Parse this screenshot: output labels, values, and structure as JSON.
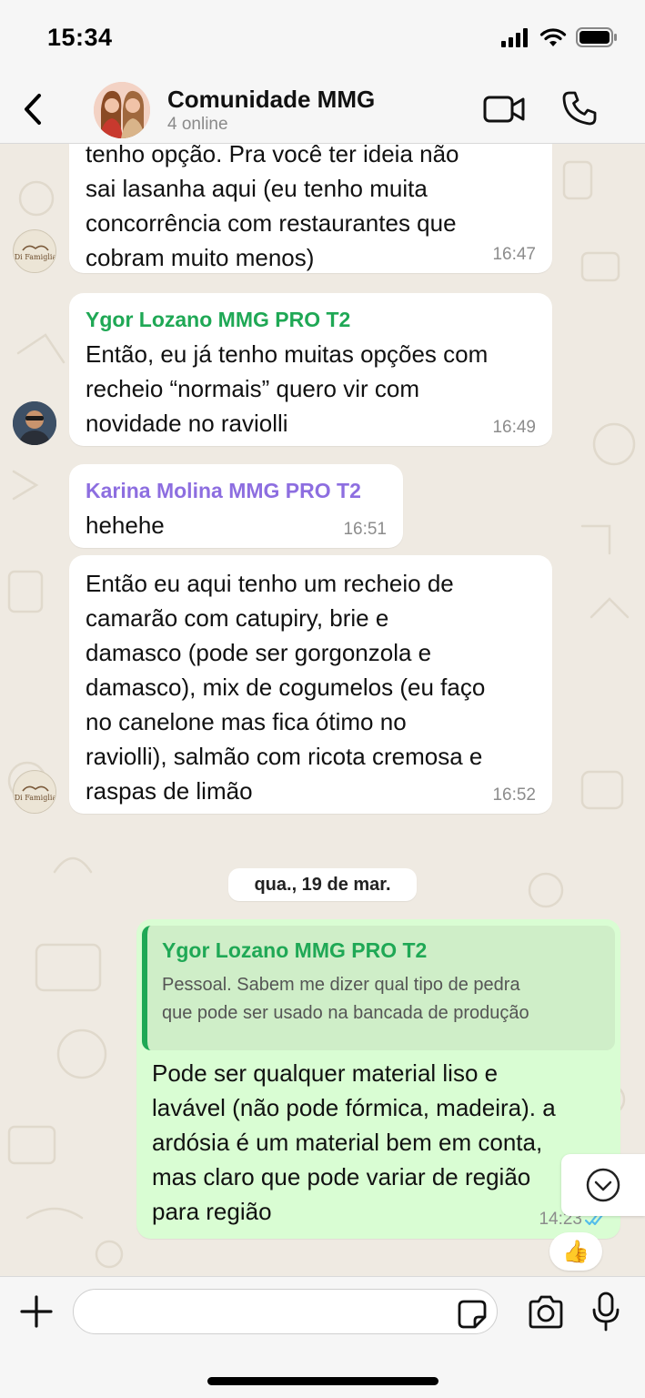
{
  "status_bar": {
    "time": "15:34"
  },
  "header": {
    "title": "Comunidade MMG",
    "subtitle": "4 online"
  },
  "messages": [
    {
      "text": "tenho opção. Pra você ter ideia não\nsai lasanha aqui (eu tenho muita\nconcorrência com restaurantes que\ncobram muito menos)",
      "time": "16:47"
    },
    {
      "sender": "Ygor Lozano MMG PRO T2",
      "text": "Então, eu já tenho muitas opções com\nrecheio “normais” quero vir com\nnovidade no raviolli",
      "time": "16:49"
    },
    {
      "sender": "Karina Molina MMG PRO T2",
      "text": "hehehe",
      "time": "16:51"
    },
    {
      "text": "Então eu aqui tenho um recheio de\ncamarão com catupiry, brie e\ndamasco (pode ser gorgonzola e\ndamasco), mix de cogumelos (eu faço\nno canelone mas fica ótimo no\nraviolli), salmão com ricota cremosa e\nraspas de limão",
      "time": "16:52"
    }
  ],
  "date_divider": "qua., 19 de mar.",
  "outgoing": {
    "quote_sender": "Ygor Lozano MMG PRO T2",
    "quote_text": "Pessoal. Sabem me dizer qual tipo de pedra\nque pode ser usado na bancada de produção",
    "text": "Pode ser qualquer material liso e\nlavável (não pode fórmica, madeira). a\nardósia é um material bem em conta,\nmas claro que pode variar de região\npara região",
    "time": "14:23",
    "reaction": "👍"
  },
  "composer": {
    "placeholder": ""
  },
  "colors": {
    "green_name": "#1fa855",
    "purple_name": "#8d6ee0",
    "outgoing_bubble": "#d9fdd3",
    "chat_background": "#efeae2",
    "read_ticks": "#53bdeb"
  }
}
